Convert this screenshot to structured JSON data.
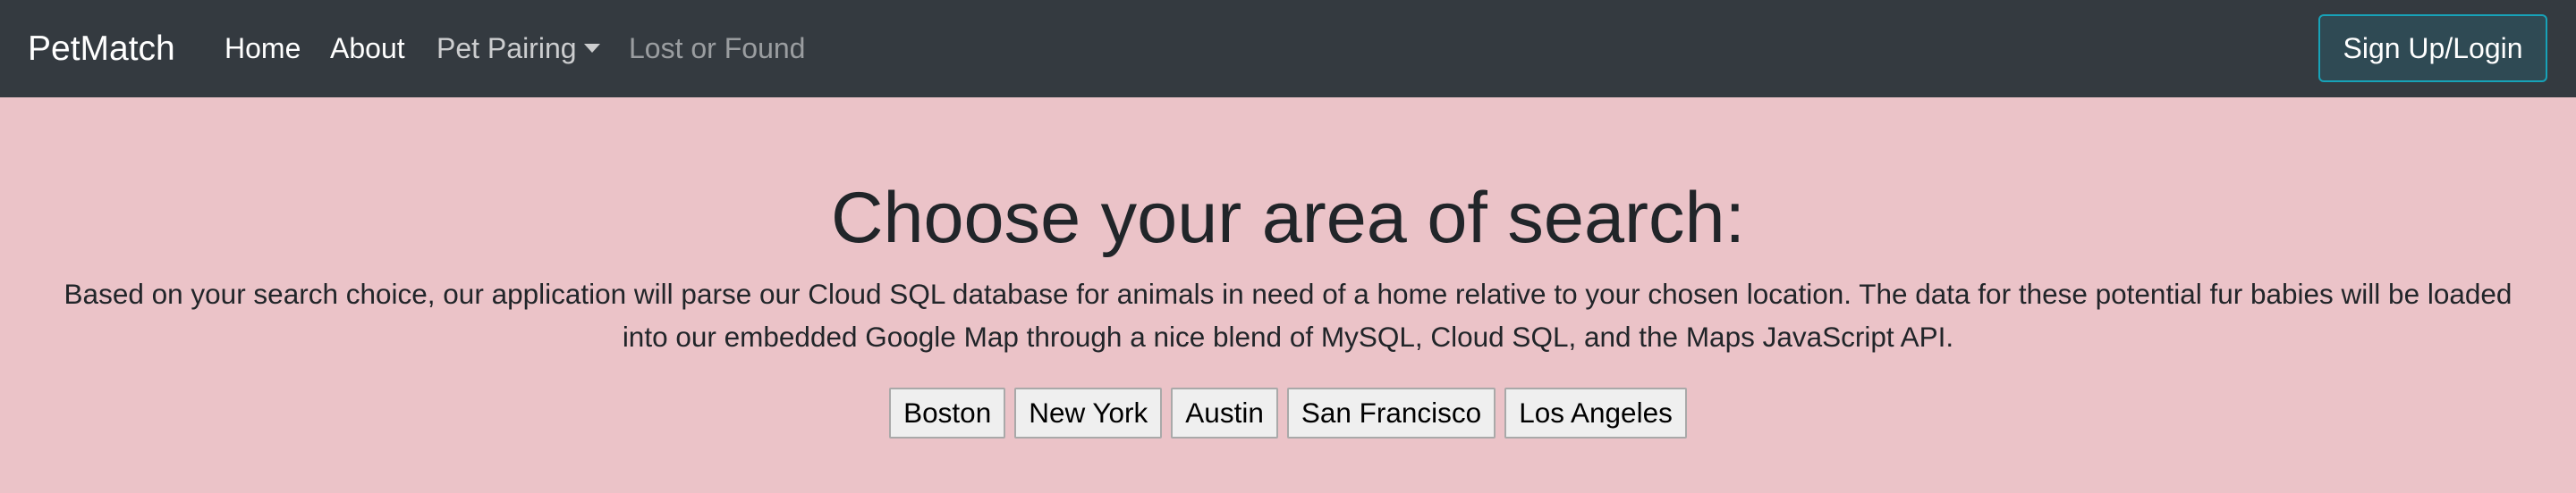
{
  "navbar": {
    "brand": "PetMatch",
    "links": {
      "home": "Home",
      "about": "About",
      "pet_pairing": "Pet Pairing",
      "lost_or_found": "Lost or Found"
    },
    "signup_label": "Sign Up/Login",
    "caret_icon": "caret-down-icon"
  },
  "main": {
    "heading": "Choose your area of search:",
    "description": "Based on your search choice, our application will parse our Cloud SQL database for animals in need of a home relative to your chosen location. The data for these potential fur babies will be loaded into our embedded Google Map through a nice blend of MySQL, Cloud SQL, and the Maps JavaScript API.",
    "cities": [
      "Boston",
      "New York",
      "Austin",
      "San Francisco",
      "Los Angeles"
    ]
  },
  "colors": {
    "navbar_bg": "#343a40",
    "page_bg": "#ebc3c8",
    "signup_border": "#17a2b8"
  }
}
